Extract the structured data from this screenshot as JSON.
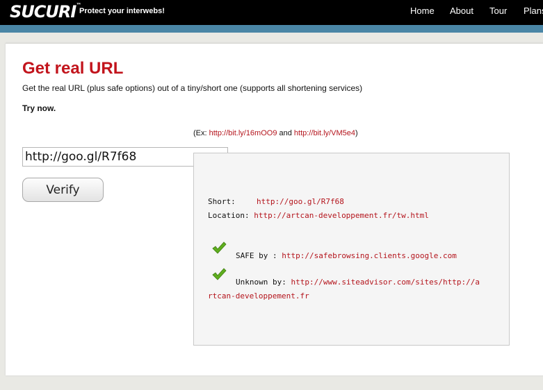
{
  "header": {
    "logo": "SUCURI",
    "logo_mark": "™",
    "tagline": "Protect your interwebs!",
    "nav": [
      {
        "label": "Home"
      },
      {
        "label": "About"
      },
      {
        "label": "Tour"
      },
      {
        "label": "Plans"
      }
    ]
  },
  "main": {
    "title": "Get real URL",
    "description": "Get the real URL (plus safe options) out of a tiny/short one (supports all shortening services)",
    "try_now": "Try now.",
    "examples": {
      "prefix": "(Ex: ",
      "link1": "http://bit.ly/16mOO9",
      "middle": " and ",
      "link2": "http://bit.ly/VM5e4",
      "suffix": ")"
    },
    "url_input_value": "http://goo.gl/R7f68",
    "verify_label": "Verify"
  },
  "result": {
    "short_label": "Short:",
    "short_value": "http://goo.gl/R7f68",
    "location_label": "Location:",
    "location_value": "http://artcan-developpement.fr/tw.html",
    "safe_label": "SAFE by :",
    "safe_value": "http://safebrowsing.clients.google.com",
    "unknown_label": "Unknown by:",
    "unknown_value_line1": "http://www.siteadvisor.com/sites/http://a",
    "unknown_value_line2": "rtcan-developpement.fr"
  },
  "colors": {
    "accent_red": "#c2141c",
    "link_red": "#b4141c",
    "check_green": "#5fae1e",
    "strip_blue": "#4a86a6"
  }
}
